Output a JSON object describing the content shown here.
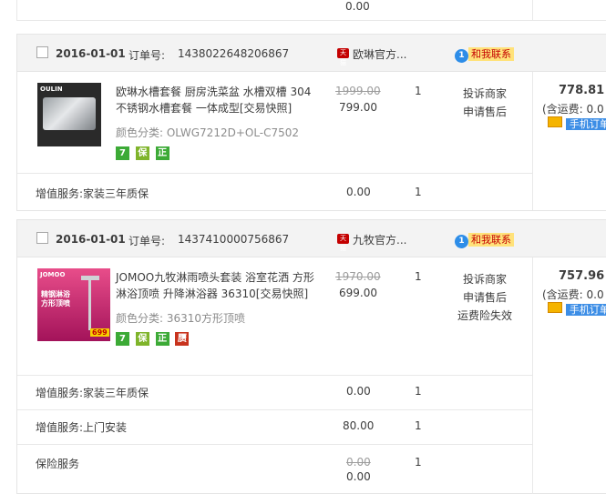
{
  "top": {
    "value": "0.00"
  },
  "orders": [
    {
      "date": "2016-01-01",
      "order_label": "订单号:",
      "order_no": "1438022648206867",
      "shop_badge": "天猫",
      "shop_name": "欧琳官方...",
      "contact": "和我联系",
      "item": {
        "title_line1": "欧琳水槽套餐 厨房洗菜盆 水槽双槽 304",
        "title_line2": "不锈钢水槽套餐 一体成型[交易快照]",
        "variant": "颜色分类: OLWG7212D+OL-C7502",
        "orig_price": "1999.00",
        "price": "799.00",
        "qty": "1",
        "actions": [
          "投诉商家",
          "申请售后"
        ],
        "badges": [
          "7",
          "保",
          "正"
        ],
        "thumb_brand": "OULIN"
      },
      "total": "778.81",
      "shipping": "(含运费: 0.0",
      "mobile": "手机订单",
      "services": [
        {
          "label": "增值服务:",
          "name": "家装三年质保",
          "price": "0.00",
          "qty": "1"
        }
      ]
    },
    {
      "date": "2016-01-01",
      "order_label": "订单号:",
      "order_no": "1437410000756867",
      "shop_badge": "天猫",
      "shop_name": "九牧官方...",
      "contact": "和我联系",
      "item": {
        "title_line1": "JOMOO九牧淋雨喷头套装 浴室花洒 方形",
        "title_line2": "淋浴顶喷 升降淋浴器 36310[交易快照]",
        "variant": "颜色分类: 36310方形顶喷",
        "orig_price": "1970.00",
        "price": "699.00",
        "qty": "1",
        "actions": [
          "投诉商家",
          "申请售后",
          "运费险失效"
        ],
        "badges": [
          "7",
          "保",
          "正",
          "赝"
        ],
        "thumb_brand": "JOMOO",
        "thumb_text": "精钢淋浴 方形顶喷",
        "thumb_price": "699"
      },
      "total": "757.96",
      "shipping": "(含运费: 0.0",
      "mobile": "手机订单",
      "services": [
        {
          "label": "增值服务:",
          "name": "家装三年质保",
          "price": "0.00",
          "qty": "1"
        },
        {
          "label": "增值服务:",
          "name": "上门安装",
          "price": "80.00",
          "qty": "1"
        },
        {
          "label": "保险服务",
          "name": "",
          "price": "0.00",
          "price2": "0.00",
          "qty": "1"
        }
      ]
    }
  ],
  "colors": {
    "accent_red": "#c40000",
    "ww_blue": "#2d8de8",
    "header_bg": "#f3f3f3"
  }
}
